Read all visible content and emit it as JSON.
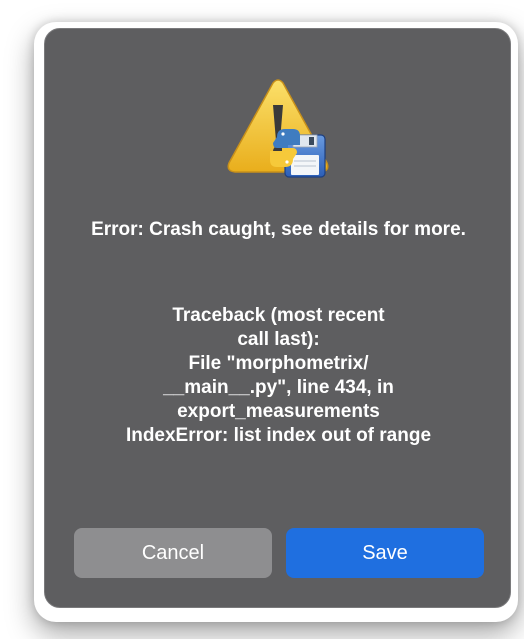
{
  "dialog": {
    "title": "Error: Crash caught, see details for more.",
    "traceback": "Traceback (most recent\ncall last):\nFile \"morphometrix/\n__main__.py\", line 434, in\nexport_measurements\nIndexError: list index out of range",
    "icon": "warning-python-launcher-icon"
  },
  "buttons": {
    "cancel_label": "Cancel",
    "save_label": "Save"
  },
  "colors": {
    "dialog_bg": "#5e5e60",
    "cancel_bg": "#8e8e90",
    "save_bg": "#1f6fe0",
    "warning_yellow": "#f2c230"
  }
}
